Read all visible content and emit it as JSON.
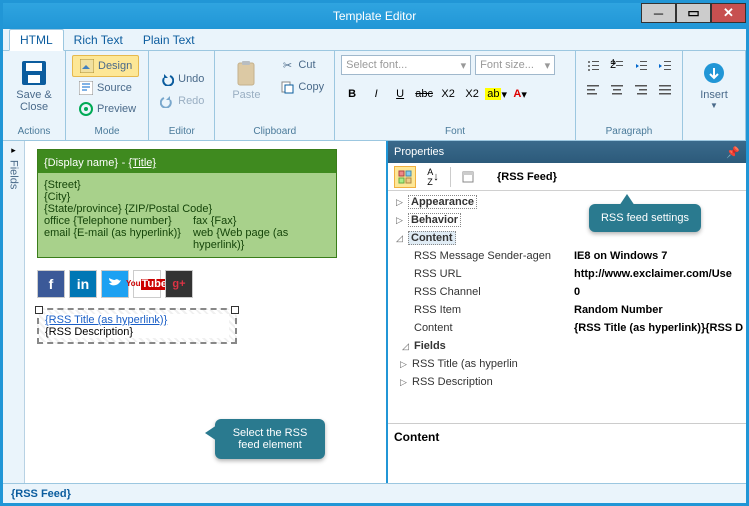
{
  "window": {
    "title": "Template Editor"
  },
  "tabs": {
    "html": "HTML",
    "richtext": "Rich Text",
    "plaintext": "Plain Text"
  },
  "ribbon": {
    "actions": {
      "label": "Actions",
      "saveclose": "Save &\nClose"
    },
    "mode": {
      "label": "Mode",
      "design": "Design",
      "source": "Source",
      "preview": "Preview"
    },
    "editor": {
      "label": "Editor",
      "undo": "Undo",
      "redo": "Redo"
    },
    "clipboard": {
      "label": "Clipboard",
      "paste": "Paste",
      "cut": "Cut",
      "copy": "Copy"
    },
    "font": {
      "label": "Font",
      "selectfont": "Select font...",
      "fontsize": "Font size..."
    },
    "paragraph": {
      "label": "Paragraph"
    },
    "insert": {
      "label": "Insert"
    }
  },
  "sidebar": {
    "fields": "Fields"
  },
  "canvas": {
    "sig_header": "{Display name}",
    "sig_title": "{Title}",
    "street": "{Street}",
    "city": "{City}",
    "state_zip": "{State/province} {ZIP/Postal Code}",
    "office_lbl": "office",
    "office_val": "{Telephone number}",
    "fax_lbl": "fax",
    "fax_val": "{Fax}",
    "email_lbl": "email",
    "email_val": "{E-mail (as hyperlink)}",
    "web_lbl": "web",
    "web_val": "{Web page (as hyperlink)}",
    "rss_title": "{RSS Title (as hyperlink)}",
    "rss_desc": "{RSS Description}",
    "rss_feed": "{RSS Feed}"
  },
  "callouts": {
    "select_rss": "Select the RSS feed element",
    "rss_settings": "RSS feed settings"
  },
  "props": {
    "title": "Properties",
    "object": "{RSS Feed}",
    "appearance": "Appearance",
    "behavior": "Behavior",
    "content": "Content",
    "fields": "Fields",
    "msg_sender": {
      "l": "RSS Message Sender-agen",
      "v": "IE8 on Windows 7"
    },
    "rss_url": {
      "l": "RSS URL",
      "v": "http://www.exclaimer.com/Use"
    },
    "rss_channel": {
      "l": "RSS Channel",
      "v": "0"
    },
    "rss_item": {
      "l": "RSS Item",
      "v": "Random Number"
    },
    "cont": {
      "l": "Content",
      "v": "{RSS Title (as hyperlink)}{RSS D"
    },
    "f1": "RSS Title (as hyperlin",
    "f2": "RSS Description",
    "desc_header": "Content"
  }
}
